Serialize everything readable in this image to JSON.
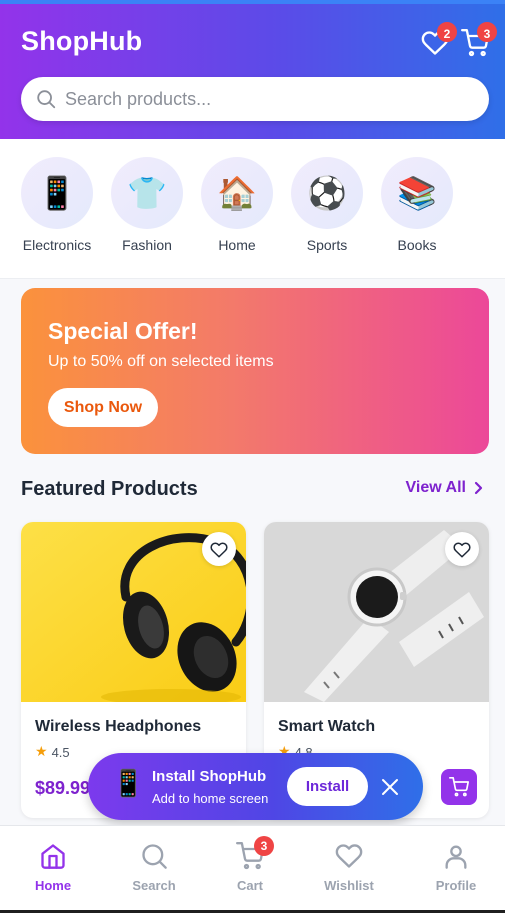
{
  "app": {
    "title": "ShopHub"
  },
  "header": {
    "wishlist_count": "2",
    "cart_count": "3",
    "search_placeholder": "Search products..."
  },
  "categories": [
    {
      "label": "Electronics",
      "icon": "mobile-phone-icon",
      "glyph": "📱"
    },
    {
      "label": "Fashion",
      "icon": "t-shirt-icon",
      "glyph": "👕"
    },
    {
      "label": "Home",
      "icon": "house-icon",
      "glyph": "🏠"
    },
    {
      "label": "Sports",
      "icon": "soccer-ball-icon",
      "glyph": "⚽"
    },
    {
      "label": "Books",
      "icon": "books-icon",
      "glyph": "📚"
    }
  ],
  "banner": {
    "title": "Special Offer!",
    "subtitle": "Up to 50% off on selected items",
    "button": "Shop Now"
  },
  "featured": {
    "title": "Featured Products",
    "view_all": "View All"
  },
  "products": [
    {
      "name": "Wireless Headphones",
      "rating": "4.5",
      "price": "$89.99",
      "image": "headphones-image"
    },
    {
      "name": "Smart Watch",
      "rating": "4.8",
      "price": "",
      "image": "smartwatch-image"
    }
  ],
  "install_prompt": {
    "title": "Install ShopHub",
    "subtitle": "Add to home screen",
    "button": "Install"
  },
  "bottom_nav": [
    {
      "label": "Home",
      "active": true
    },
    {
      "label": "Search",
      "active": false
    },
    {
      "label": "Cart",
      "active": false,
      "badge": "3"
    },
    {
      "label": "Wishlist",
      "active": false
    },
    {
      "label": "Profile",
      "active": false
    }
  ],
  "colors": {
    "accent": "#9333ea",
    "header_gradient_start": "#9333ea",
    "header_gradient_end": "#2f6fe8",
    "badge": "#ef4444",
    "banner_start": "#fb923c",
    "banner_end": "#ec4899"
  }
}
